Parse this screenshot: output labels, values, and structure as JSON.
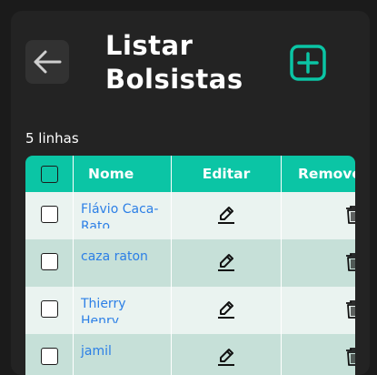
{
  "header": {
    "title_line1": "Listar",
    "title_line2": "Bolsistas"
  },
  "icons": {
    "back": "arrow-left-icon",
    "add": "plus-square-icon",
    "edit": "pencil-icon",
    "remove": "trash-icon"
  },
  "colors": {
    "accent": "#0bc5a5",
    "link": "#2c7fe6",
    "row_odd": "#eaf3f0",
    "row_even": "#c6e0d8"
  },
  "table": {
    "row_count": "5 linhas",
    "columns": [
      "Nome",
      "Editar",
      "Remover"
    ],
    "rows": [
      {
        "nome": "Flávio Caca-Rato"
      },
      {
        "nome": "caza raton"
      },
      {
        "nome": "Thierry Henry"
      },
      {
        "nome": "jamil"
      }
    ]
  }
}
